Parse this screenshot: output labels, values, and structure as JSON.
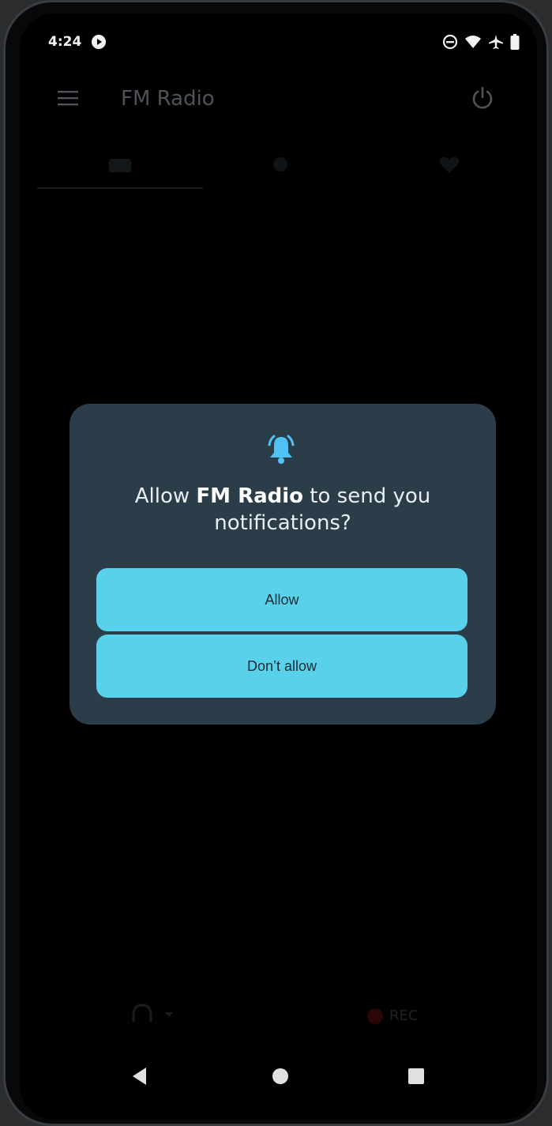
{
  "status_bar": {
    "time": "4:24",
    "icons": [
      "media-play-icon",
      "do-not-disturb-icon",
      "wifi-icon",
      "airplane-icon",
      "battery-icon"
    ]
  },
  "app_bar": {
    "title": "FM Radio",
    "menu_icon": "hamburger-menu-icon",
    "power_icon": "power-icon"
  },
  "dialog": {
    "icon": "bell-ringing-icon",
    "message_prefix": "Allow ",
    "app_name": "FM Radio",
    "message_suffix": " to send you notifications?",
    "allow_label": "Allow",
    "deny_label": "Don’t allow"
  },
  "background_controls": {
    "rec_label": "REC"
  },
  "nav_bar": {
    "back_icon": "back-triangle-icon",
    "home_icon": "home-circle-icon",
    "recents_icon": "recents-square-icon"
  },
  "colors": {
    "dialog_bg": "#2c3d4a",
    "button_bg": "#5ad1ea",
    "accent": "#4fc3f7"
  }
}
